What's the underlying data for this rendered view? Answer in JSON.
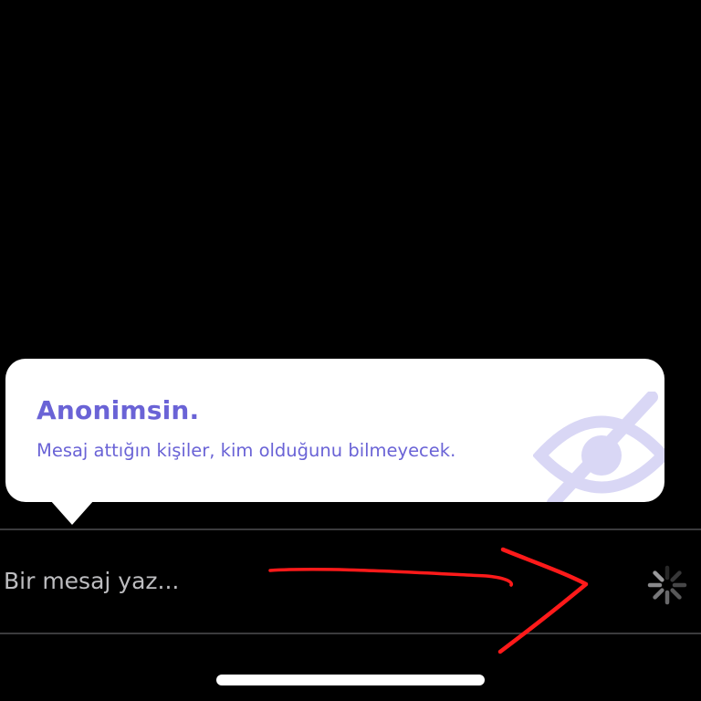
{
  "tooltip": {
    "title": "Anonimsin.",
    "body": "Mesaj attığın kişiler, kim olduğunu bilmeyecek.",
    "icon": "eye-slash-icon",
    "accent_color": "#6a63d6",
    "icon_color": "#d9d7f5"
  },
  "composer": {
    "placeholder": "Bir mesaj yaz...",
    "value": "",
    "send_state_icon": "loading-spinner-icon"
  },
  "annotation": {
    "icon": "red-arrow-annotation",
    "color": "#ff1a1a"
  },
  "system": {
    "home_indicator_color": "#ffffff"
  }
}
